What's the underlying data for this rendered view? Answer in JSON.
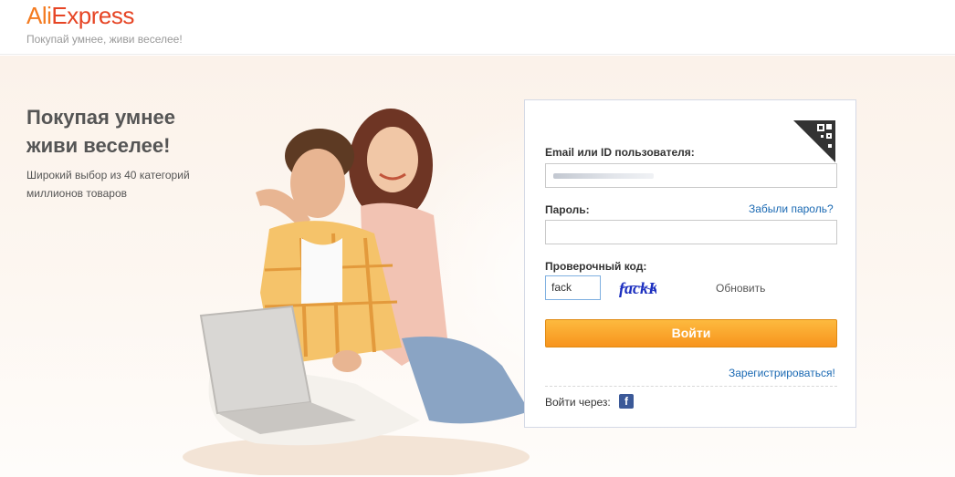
{
  "header": {
    "logo_part1": "Ali",
    "logo_part2": "Express",
    "tagline": "Покупай умнее, живи веселее!"
  },
  "promo": {
    "title_line1": "Покупая умнее",
    "title_line2": "живи веселее!",
    "subtitle_line1": "Широкий выбор из 40 категорий",
    "subtitle_line2": "миллионов товаров"
  },
  "login": {
    "email_label": "Email или ID пользователя:",
    "password_label": "Пароль:",
    "forgot_password": "Забыли пароль?",
    "captcha_label": "Проверочный код:",
    "captcha_value": "fack",
    "captcha_image_text": "fackK",
    "refresh_label": "Обновить",
    "submit_label": "Войти",
    "register_link": "Зарегистрироваться!",
    "social_label": "Войти через:",
    "social_icon": "facebook-icon"
  },
  "colors": {
    "brand_orange": "#f47b20",
    "brand_red": "#e64525",
    "button_orange": "#f7941d",
    "link_blue": "#1a69b3",
    "facebook_blue": "#3b5998"
  }
}
